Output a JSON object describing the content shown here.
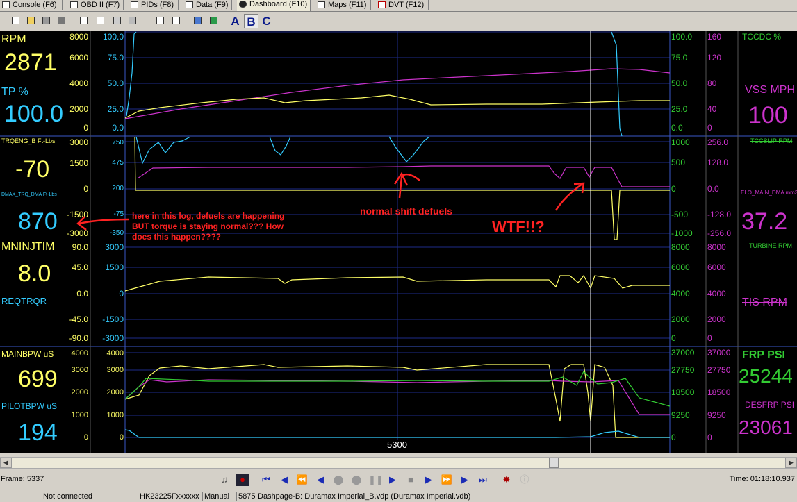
{
  "tabs": [
    {
      "label": "Console (F6)",
      "active": false
    },
    {
      "label": "OBD II (F7)",
      "active": false
    },
    {
      "label": "PIDs (F8)",
      "active": false
    },
    {
      "label": "Data (F9)",
      "active": false
    },
    {
      "label": "Dashboard (F10)",
      "active": true
    },
    {
      "label": "Maps (F11)",
      "active": false
    },
    {
      "label": "DVT (F12)",
      "active": false
    }
  ],
  "toolbar": {
    "letter_a": "A",
    "letter_b": "B",
    "letter_c": "C",
    "selected": "B"
  },
  "colors": {
    "yellow": "#ffff66",
    "cyan": "#33ccff",
    "magenta": "#cc33cc",
    "green": "#33cc33",
    "red": "#ff2222",
    "grid": "#1e2c8a"
  },
  "gauges": {
    "rpm": {
      "label": "RPM",
      "value": "2871"
    },
    "tp": {
      "label": "TP %",
      "value": "100.0"
    },
    "tccdc": {
      "label": "TCCDC %"
    },
    "vss": {
      "label": "VSS MPH",
      "value": "100"
    },
    "trqeng": {
      "label": "TRQENG_B Ft-Lbs",
      "value": "-70"
    },
    "dmax_trq": {
      "label": "DMAX_TRQ_DMA Ft-Lbs",
      "value": "870"
    },
    "tccslip": {
      "label": "TCCSLIP RPM"
    },
    "elo": {
      "label": "ELO_MAIN_DMA mm3",
      "value": "37.2"
    },
    "mninjtim": {
      "label": "MNINJTIM",
      "value": "8.0"
    },
    "reqtrqr": {
      "label": "REQTRQR"
    },
    "turbine": {
      "label": "TURBINE RPM"
    },
    "tis": {
      "label": "TIS RPM"
    },
    "mainbpw": {
      "label": "MAINBPW uS",
      "value": "699"
    },
    "pilotbpw": {
      "label": "PILOTBPW uS",
      "value": "194"
    },
    "frp": {
      "label": "FRP PSI",
      "value": "25244"
    },
    "desfrp": {
      "label": "DESFRP PSI",
      "value": "23061"
    }
  },
  "axes": {
    "p1": {
      "a": [
        "8000",
        "6000",
        "4000",
        "2000",
        "0"
      ],
      "b": [
        "100.0",
        "75.0",
        "50.0",
        "25.0",
        "0.0"
      ],
      "c": [
        "100.0",
        "75.0",
        "50.0",
        "25.0",
        "0.0"
      ],
      "d": [
        "160",
        "120",
        "80",
        "40",
        "0"
      ]
    },
    "p2": {
      "a": [
        "3000",
        "1500",
        "0",
        "-1500",
        "-3000"
      ],
      "b": [
        "750",
        "475",
        "200",
        "-75",
        "-350"
      ],
      "c": [
        "1000",
        "500",
        "0",
        "-500",
        "-1000"
      ],
      "d": [
        "256.0",
        "128.0",
        "0.0",
        "-128.0",
        "-256.0"
      ]
    },
    "p3": {
      "a": [
        "90.0",
        "45.0",
        "0.0",
        "-45.0",
        "-90.0"
      ],
      "b": [
        "3000",
        "1500",
        "0",
        "-1500",
        "-3000"
      ],
      "c": [
        "8000",
        "6000",
        "4000",
        "2000",
        "0"
      ],
      "d": [
        "8000",
        "6000",
        "4000",
        "2000",
        "0"
      ]
    },
    "p4": {
      "a": [
        "4000",
        "3000",
        "2000",
        "1000",
        "0"
      ],
      "b": [
        "4000",
        "3000",
        "2000",
        "1000",
        "0"
      ],
      "c": [
        "37000",
        "27750",
        "18500",
        "9250",
        "0"
      ],
      "d": [
        "37000",
        "27750",
        "18500",
        "9250",
        "0"
      ]
    }
  },
  "annotations": {
    "note": [
      "here in this log, defuels are happening",
      "BUT torque is staying normal??? How",
      "does this happen????"
    ],
    "shift": "normal shift defuels",
    "wtf": "WTF!!?"
  },
  "cursor_label": "5300",
  "frame": "Frame: 5337",
  "time": "Time: 01:18:10.937",
  "status": {
    "connection": "Not connected",
    "vin": "HK23225Fxxxxxx",
    "trans": "Manual",
    "num": "5875",
    "dashpage": "Dashpage-B: Duramax Imperial_B.vdp (Duramax Imperial.vdb)"
  }
}
